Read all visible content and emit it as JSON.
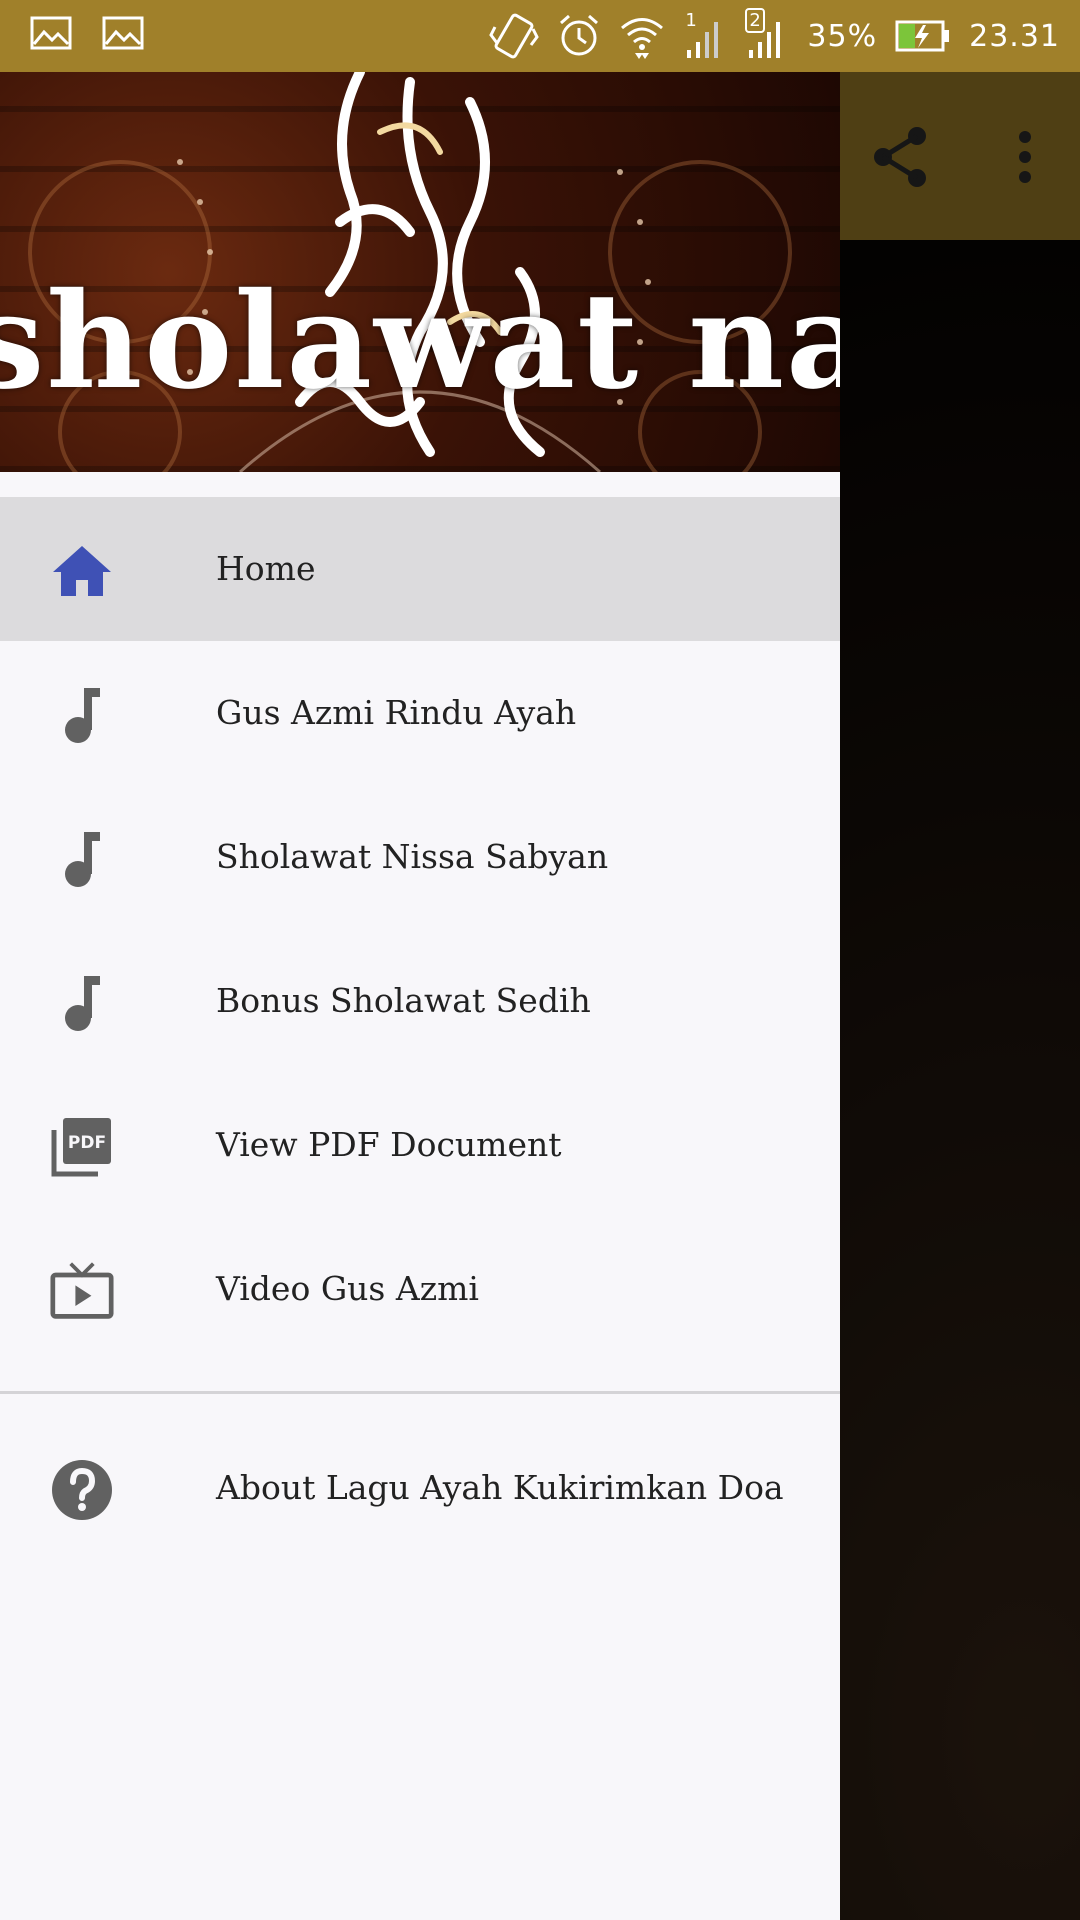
{
  "status_bar": {
    "battery": "35%",
    "time": "23.31",
    "sim1": "1",
    "sim2": "2"
  },
  "drawer": {
    "header_title": "sholawat nab",
    "items": [
      {
        "label": "Home",
        "icon": "home-icon",
        "selected": true
      },
      {
        "label": "Gus Azmi Rindu Ayah",
        "icon": "music-note-icon"
      },
      {
        "label": "Sholawat Nissa Sabyan",
        "icon": "music-note-icon"
      },
      {
        "label": "Bonus Sholawat Sedih",
        "icon": "music-note-icon"
      },
      {
        "label": "View PDF Document",
        "icon": "pdf-icon"
      },
      {
        "label": "Video Gus Azmi",
        "icon": "video-icon"
      }
    ],
    "secondary_items": [
      {
        "label": "About Lagu Ayah Kukirimkan Doa",
        "icon": "help-icon"
      }
    ]
  },
  "colors": {
    "status_bar": "#a0802a",
    "home_icon": "#3f51b5",
    "menu_icon": "#616161",
    "selected_bg": "#dcdbdd"
  }
}
